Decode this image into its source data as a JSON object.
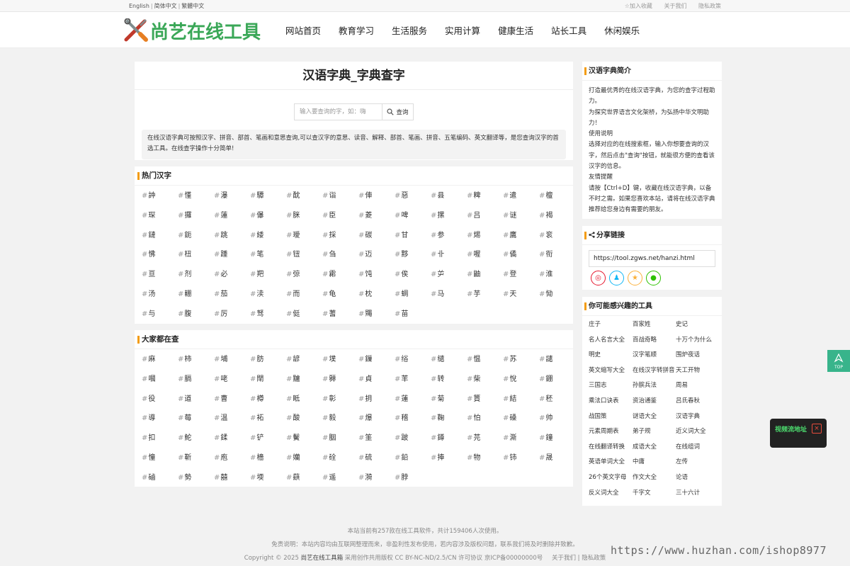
{
  "topbar": {
    "lang_en": "English",
    "lang_sc": "简体中文",
    "lang_tc": "繁體中文",
    "bookmark": "☆加入收藏",
    "about": "关于我们",
    "privacy": "隐私政策"
  },
  "logo": {
    "text": "尚艺在线工具"
  },
  "nav": [
    "网站首页",
    "教育学习",
    "生活服务",
    "实用计算",
    "健康生活",
    "站长工具",
    "休闲娱乐"
  ],
  "main": {
    "title": "汉语字典_字典查字",
    "search": {
      "placeholder": "输入要查询的字，如：嗨",
      "button": "查询"
    },
    "description": "在线汉语字典可按照汉字、拼音、部首、笔画和意思查询,可以查汉字的意思、读音、解释、部首、笔画、拼音、五笔编码、英文翻译等，是您查询汉字的首选工具。在线查字操作十分简单!"
  },
  "hot": {
    "title": "热门汉字",
    "chars": [
      "訲",
      "慬",
      "瀑",
      "驔",
      "酖",
      "诣",
      "俥",
      "惡",
      "县",
      "粺",
      "遣",
      "檀",
      "琛",
      "攞",
      "蓮",
      "儤",
      "脒",
      "臣",
      "菱",
      "啤",
      "摞",
      "吕",
      "谜",
      "褐",
      "鏈",
      "鈪",
      "跳",
      "緌",
      "璦",
      "採",
      "碳",
      "甘",
      "参",
      "焬",
      "鷹",
      "衮",
      "怫",
      "杻",
      "踵",
      "笔",
      "钮",
      "刍",
      "迈",
      "黟",
      "卝",
      "喔",
      "僪",
      "衔",
      "亘",
      "剂",
      "必",
      "羓",
      "弶",
      "霦",
      "饨",
      "俟",
      "屰",
      "鼬",
      "登",
      "淮",
      "汤",
      "輣",
      "茄",
      "渎",
      "而",
      "龟",
      "枕",
      "蜩",
      "马",
      "芋",
      "天",
      "恸",
      "与",
      "腹",
      "厉",
      "驽",
      "侹",
      "蓍",
      "鼆",
      "苗"
    ]
  },
  "popular": {
    "title": "大家都在查",
    "chars": [
      "麻",
      "柿",
      "埔",
      "肪",
      "諺",
      "墣",
      "鏁",
      "绤",
      "缱",
      "愠",
      "苏",
      "譴",
      "嘓",
      "膈",
      "咾",
      "閛",
      "黸",
      "顨",
      "貞",
      "䒠",
      "转",
      "柴",
      "悅",
      "錋",
      "役",
      "道",
      "曹",
      "樽",
      "眡",
      "彰",
      "抈",
      "蓮",
      "菊",
      "篢",
      "結",
      "秠",
      "導",
      "莓",
      "溫",
      "袥",
      "酸",
      "毅",
      "爆",
      "稽",
      "鞠",
      "怕",
      "磉",
      "帅",
      "扣",
      "鮀",
      "鍒",
      "铲",
      "鬢",
      "胭",
      "筀",
      "跛",
      "鐏",
      "芫",
      "澌",
      "鐘",
      "憧",
      "靳",
      "庖",
      "檣",
      "孏",
      "硂",
      "硫",
      "鉛",
      "捧",
      "物",
      "铈",
      "晟",
      "磠",
      "勢",
      "囍",
      "堧",
      "蕻",
      "遥",
      "漪",
      "脖"
    ]
  },
  "side": {
    "intro_title": "汉语字典简介",
    "intro_lines": [
      "打造最优秀的在线汉语字典，为您的查字过程助力。",
      "为探究世界语言文化架桥，为弘扬中华文明助力！",
      "使用说明",
      "选择对应的在线搜索框，输入你想要查询的汉字，然后点击\"查询\"按钮，就能很方便的查看该汉字的信息。",
      "友情提醒",
      "请按【Ctrl+D】键，收藏在线汉语字典，以备不时之需。如果您喜欢本站，请将在线汉语字典推荐给您身边有需要的朋友。"
    ],
    "share_title": "分享链接",
    "share_url": "https://tool.zgws.net/hanzi.html",
    "share_icons": [
      {
        "icon": "weibo-icon",
        "color": "#e6162d",
        "glyph": "◎"
      },
      {
        "icon": "qq-icon",
        "color": "#12b7f5",
        "glyph": "♟"
      },
      {
        "icon": "qzone-icon",
        "color": "#fbb03b",
        "glyph": "★"
      },
      {
        "icon": "wechat-icon",
        "color": "#2dc100",
        "glyph": "●"
      }
    ],
    "tools_title": "你可能感兴趣的工具",
    "tools": [
      "庄子",
      "百家姓",
      "史记",
      "名人名言大全",
      "百战奇略",
      "十万个为什么",
      "明史",
      "汉字笔顺",
      "围炉夜话",
      "英文缩写大全",
      "在线汉字转拼音",
      "天工开物",
      "三国志",
      "孙膑兵法",
      "周易",
      "乘法口诀表",
      "资治通鉴",
      "吕氏春秋",
      "战国策",
      "谜语大全",
      "汉语字典",
      "元素周期表",
      "弟子规",
      "近义词大全",
      "在线翻译转换",
      "成语大全",
      "在线组词",
      "英语单词大全",
      "中庸",
      "左传",
      "26个英文字母",
      "作文大全",
      "论语",
      "反义词大全",
      "千字文",
      "三十六计"
    ]
  },
  "footer": {
    "line1": "本站当前有257款在线工具软件，共计159406人次使用。",
    "line2": "免责说明：本站内容均由互联网整理而来，非盈利性发布使用，若内容涉及版权问题，联系我们将及时删除并致歉。",
    "line3_prefix": "Copyright © 2025",
    "line3_site": "尚艺在线工具箱",
    "line3_license": "采用创作共用版权 CC BY-NC-ND/2.5/CN 许可协议",
    "line3_icp": "京ICP备00000000号",
    "line3_links": "关于我们 | 隐私政策"
  },
  "totop": {
    "label": "TOP"
  },
  "video_popup": {
    "label": "视频流地址",
    "close": "×"
  },
  "watermark": "https://www.huzhan.com/ishop8977"
}
